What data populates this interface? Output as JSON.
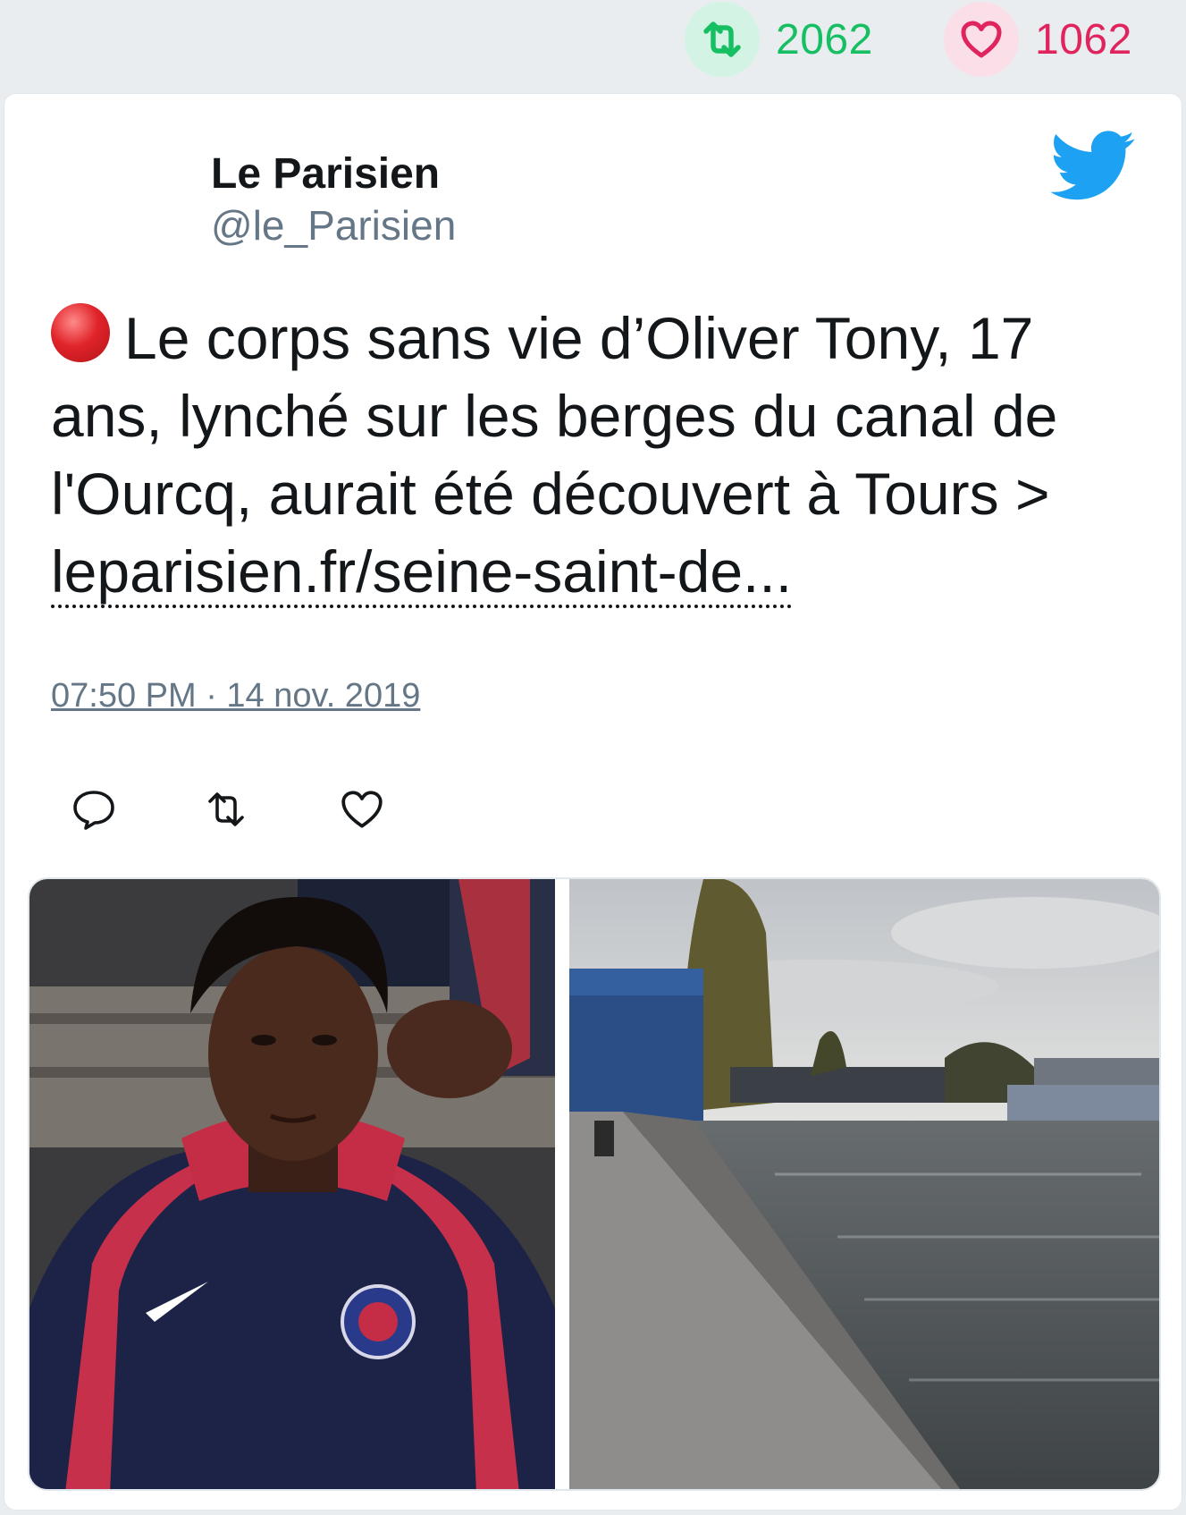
{
  "stats": {
    "retweet_icon": "retweet-icon",
    "retweet_count": "2062",
    "like_icon": "heart-icon",
    "like_count": "1062",
    "retweet_color": "#17bf63",
    "like_color": "#e0245e"
  },
  "tweet": {
    "author_name": "Le Parisien",
    "author_handle": "@le_Parisien",
    "brand_icon": "twitter-bird-icon",
    "brand_color": "#1da1f2",
    "emoji": "red-circle-emoji",
    "text": "Le corps sans vie d’Oliver Tony, 17 ans, lynché sur les berges du canal de l'Ourcq, aurait été découvert à Tours > ",
    "link_text": "leparisien.fr/seine-saint-de...",
    "timestamp": "07:50 PM · 14 nov. 2019"
  },
  "actions": [
    {
      "name": "reply",
      "icon": "reply-icon"
    },
    {
      "name": "retweet",
      "icon": "retweet-icon"
    },
    {
      "name": "like",
      "icon": "heart-icon"
    }
  ],
  "media": {
    "count": 2,
    "photo_left": "portrait photo of a teenager in a navy and red hooded sports jacket",
    "photo_right": "photo of a canal bank with a stone walkway, water and trees"
  }
}
